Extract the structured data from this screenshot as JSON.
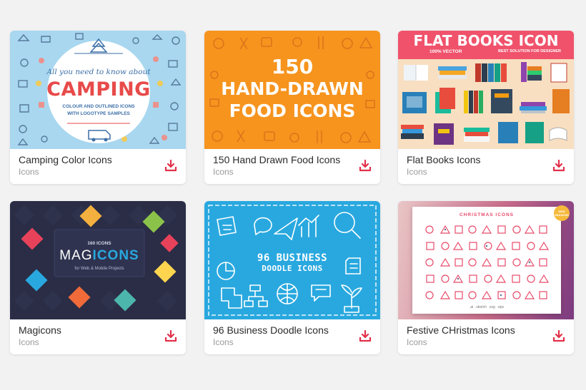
{
  "cards": [
    {
      "title": "Camping Color Icons",
      "category": "Icons",
      "thumb": {
        "line1": "All you need to know about",
        "headline": "CAMPING",
        "sub1": "COLOUR AND OUTLINED ICONS",
        "sub2": "WITH LOGOTYPE SAMPLES"
      }
    },
    {
      "title": "150 Hand Drawn Food Icons",
      "category": "Icons",
      "thumb": {
        "line1": "150",
        "line2": "HAND-DRAWN",
        "line3": "FOOD ICONS"
      }
    },
    {
      "title": "Flat Books Icons",
      "category": "Icons",
      "thumb": {
        "headline": "FLAT BOOKS ICON",
        "left": "100% VECTOR",
        "right": "BEST SOLUTION FOR DESIGNER"
      }
    },
    {
      "title": "Magicons",
      "category": "Icons",
      "thumb": {
        "count": "160 ICONS",
        "name_a": "MAG",
        "name_b": "ICONS",
        "sub": "for Web & Mobile Projects"
      }
    },
    {
      "title": "96 Business Doodle Icons",
      "category": "Icons",
      "thumb": {
        "line1": "96 BUSINESS",
        "line2": "DOODLE ICONS"
      }
    },
    {
      "title": "Festive CHristmas Icons",
      "category": "Icons",
      "thumb": {
        "heading": "CHRISTMAS ICONS",
        "badge": "NEW SEASONS",
        "formats": ".ai  .sketch  .svg  .eps"
      }
    }
  ],
  "colors": {
    "page_bg": "#f2f2f3",
    "download_icon": "#e3304b",
    "camping_bg": "#a8d7ef",
    "camping_red": "#e84a4a",
    "food_bg": "#f6941e",
    "books_header": "#f0526b",
    "books_bg": "#f8dfc1",
    "magicons_bg": "#2a2d45",
    "doodle_bg": "#29a8df",
    "christmas_accent": "#8a3b7e"
  },
  "icons": {
    "download": "download-arrow-icon"
  }
}
